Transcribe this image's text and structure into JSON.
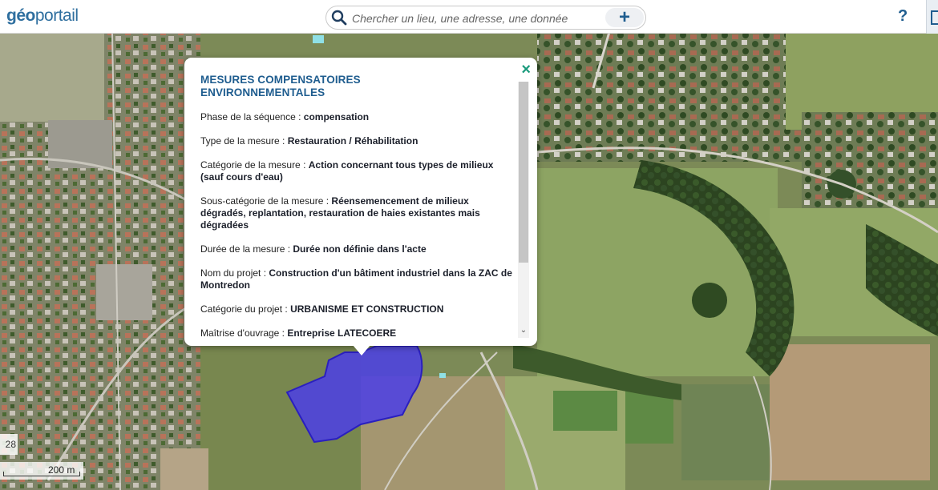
{
  "header": {
    "logo_part1": "géo",
    "logo_part2": "",
    "logo_part3": "portail",
    "search_placeholder": "Chercher un lieu, une adresse, une donnée",
    "add_label": "+",
    "help_label": "?"
  },
  "popup": {
    "title": "MESURES COMPENSATOIRES ENVIRONNEMENTALES",
    "close_label": "×",
    "fields": [
      {
        "key": "Phase de la séquence : ",
        "value": "compensation"
      },
      {
        "key": "Type de la mesure : ",
        "value": "Restauration / Réhabilitation"
      },
      {
        "key": "Catégorie de la mesure : ",
        "value": "Action concernant tous types de milieux (sauf cours d'eau)"
      },
      {
        "key": "Sous-catégorie de la mesure : ",
        "value": "Réensemencement de milieux dégradés, replantation, restauration de haies existantes mais dégradées"
      },
      {
        "key": "Durée de la mesure : ",
        "value": "Durée non définie dans l'acte"
      },
      {
        "key": "Nom du projet : ",
        "value": "Construction d'un bâtiment industriel dans la ZAC de Montredon"
      },
      {
        "key": "Catégorie du projet : ",
        "value": "URBANISME ET CONSTRUCTION"
      },
      {
        "key": "Maîtrise d'ouvrage : ",
        "value": "Entreprise LATECOERE"
      }
    ]
  },
  "map": {
    "zoom_level": "28",
    "scale_label": "200 m",
    "selection_fill": "#4b3ee6",
    "selection_stroke": "#2a1fbf"
  }
}
